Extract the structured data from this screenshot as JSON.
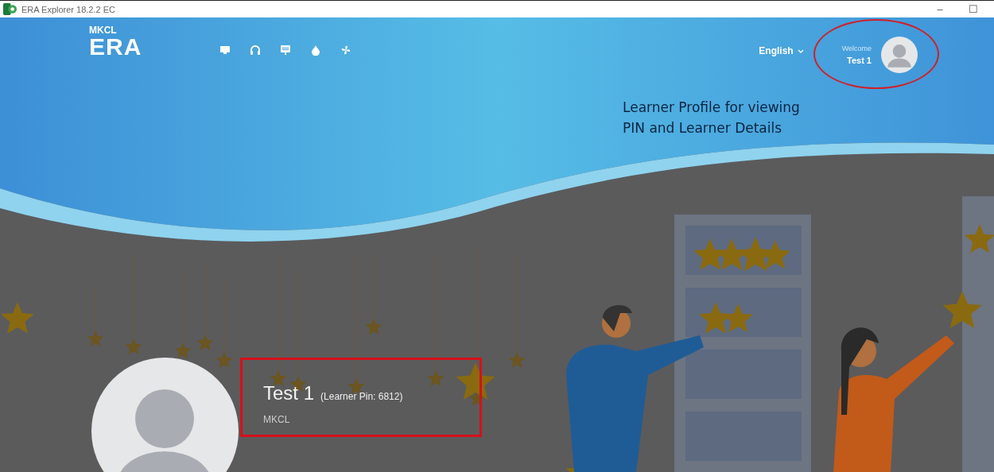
{
  "window": {
    "title": "ERA Explorer 18.2.2 EC",
    "controls": [
      "–",
      "☐"
    ]
  },
  "header": {
    "logo_small": "MKCL",
    "logo_large": "ERA",
    "language": "English",
    "welcome": "Welcome",
    "user_name": "Test 1"
  },
  "callout": [
    "Learner Profile for viewing",
    "PIN and Learner Details"
  ],
  "profile": {
    "name": "Test 1",
    "pin": "(Learner Pin: 6812)",
    "organization": "MKCL"
  }
}
